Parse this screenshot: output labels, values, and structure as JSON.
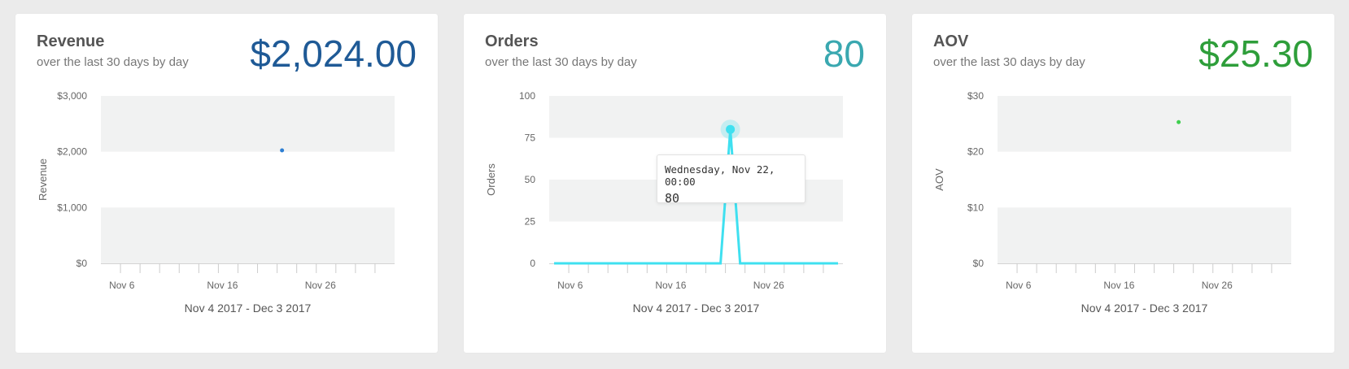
{
  "cards": [
    {
      "title": "Revenue",
      "subtitle": "over the last 30 days by day",
      "value": "$2,024.00",
      "value_color": "#1f5a96",
      "mark_color": "#2d7fd3",
      "date_range": "Nov 4 2017 - Dec 3 2017"
    },
    {
      "title": "Orders",
      "subtitle": "over the last 30 days by day",
      "value": "80",
      "value_color": "#3aa8b0",
      "mark_color": "#3fe0f0",
      "date_range": "Nov 4 2017 - Dec 3 2017",
      "tooltip": {
        "date": "Wednesday, Nov 22, 00:00",
        "value": "80"
      }
    },
    {
      "title": "AOV",
      "subtitle": "over the last 30 days by day",
      "value": "$25.30",
      "value_color": "#2e9e3a",
      "mark_color": "#3fcf4f",
      "date_range": "Nov 4 2017 - Dec 3 2017"
    }
  ],
  "chart_data": [
    {
      "type": "scatter",
      "ylabel": "Revenue",
      "xlabel": "Nov 4 2017 - Dec 3 2017",
      "ylim": [
        0,
        3000
      ],
      "yticks": [
        0,
        1000,
        2000,
        3000
      ],
      "ytick_labels": [
        "$0",
        "$1,000",
        "$2,000",
        "$3,000"
      ],
      "x_ticks": [
        "2017-11-06",
        "2017-11-16",
        "2017-11-26"
      ],
      "x_tick_labels": [
        "Nov 6",
        "Nov 16",
        "Nov 26"
      ],
      "xlim": [
        "2017-11-04",
        "2017-12-03"
      ],
      "grid": "alternating bands",
      "series": [
        {
          "x": [
            "2017-11-22"
          ],
          "values": [
            2024
          ]
        }
      ]
    },
    {
      "type": "line",
      "ylabel": "Orders",
      "xlabel": "Nov 4 2017 - Dec 3 2017",
      "ylim": [
        0,
        100
      ],
      "yticks": [
        0,
        25,
        50,
        75,
        100
      ],
      "ytick_labels": [
        "0",
        "25",
        "50",
        "75",
        "100"
      ],
      "x_ticks": [
        "2017-11-06",
        "2017-11-16",
        "2017-11-26"
      ],
      "x_tick_labels": [
        "Nov 6",
        "Nov 16",
        "Nov 26"
      ],
      "xlim": [
        "2017-11-04",
        "2017-12-03"
      ],
      "grid": "alternating bands",
      "series": [
        {
          "x": [
            "2017-11-04",
            "2017-11-05",
            "2017-11-06",
            "2017-11-07",
            "2017-11-08",
            "2017-11-09",
            "2017-11-10",
            "2017-11-11",
            "2017-11-12",
            "2017-11-13",
            "2017-11-14",
            "2017-11-15",
            "2017-11-16",
            "2017-11-17",
            "2017-11-18",
            "2017-11-19",
            "2017-11-20",
            "2017-11-21",
            "2017-11-22",
            "2017-11-23",
            "2017-11-24",
            "2017-11-25",
            "2017-11-26",
            "2017-11-27",
            "2017-11-28",
            "2017-11-29",
            "2017-11-30",
            "2017-12-01",
            "2017-12-02",
            "2017-12-03"
          ],
          "values": [
            0,
            0,
            0,
            0,
            0,
            0,
            0,
            0,
            0,
            0,
            0,
            0,
            0,
            0,
            0,
            0,
            0,
            0,
            80,
            0,
            0,
            0,
            0,
            0,
            0,
            0,
            0,
            0,
            0,
            0
          ]
        }
      ]
    },
    {
      "type": "scatter",
      "ylabel": "AOV",
      "xlabel": "Nov 4 2017 - Dec 3 2017",
      "ylim": [
        0,
        30
      ],
      "yticks": [
        0,
        10,
        20,
        30
      ],
      "ytick_labels": [
        "$0",
        "$10",
        "$20",
        "$30"
      ],
      "x_ticks": [
        "2017-11-06",
        "2017-11-16",
        "2017-11-26"
      ],
      "x_tick_labels": [
        "Nov 6",
        "Nov 16",
        "Nov 26"
      ],
      "xlim": [
        "2017-11-04",
        "2017-12-03"
      ],
      "grid": "alternating bands",
      "series": [
        {
          "x": [
            "2017-11-22"
          ],
          "values": [
            25.3
          ]
        }
      ]
    }
  ]
}
